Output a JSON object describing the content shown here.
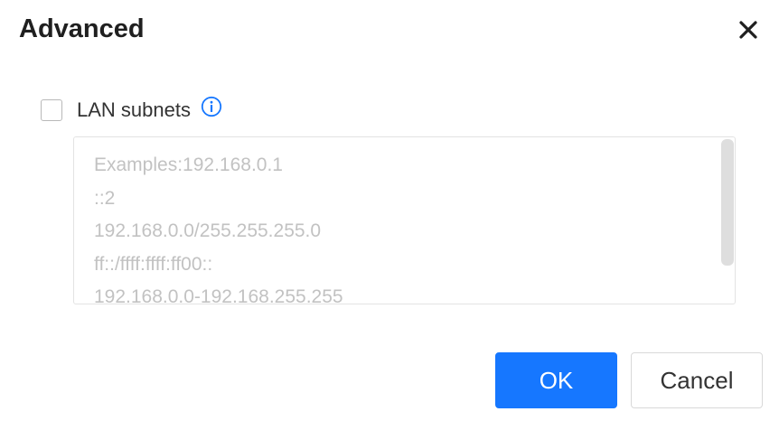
{
  "dialog": {
    "title": "Advanced",
    "close_icon": "close-icon"
  },
  "option": {
    "label": "LAN subnets",
    "checked": false,
    "info_icon": "info-icon",
    "accent_color": "#1677ff"
  },
  "subnets_field": {
    "value": "",
    "placeholder_lines": [
      "Examples:192.168.0.1",
      "::2",
      "192.168.0.0/255.255.255.0",
      "ff::/ffff:ffff:ff00::",
      "192.168.0.0-192.168.255.255"
    ]
  },
  "footer": {
    "ok_label": "OK",
    "cancel_label": "Cancel"
  }
}
